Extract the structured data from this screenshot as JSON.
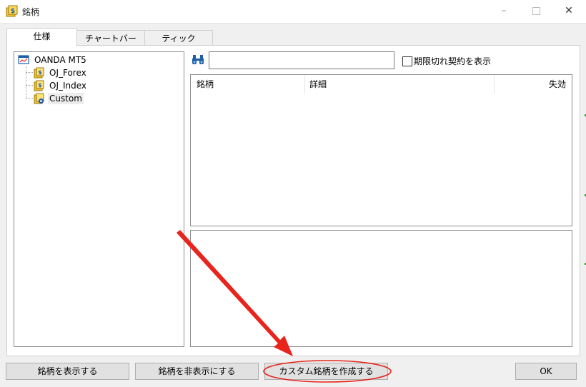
{
  "window": {
    "title": "銘柄",
    "icon": "symbols-app-icon",
    "controls": {
      "minimize": "–",
      "close": "✕"
    }
  },
  "tabs": [
    {
      "label": "仕様",
      "active": true
    },
    {
      "label": "チャートバー",
      "active": false
    },
    {
      "label": "ティック",
      "active": false
    }
  ],
  "tree": {
    "root": {
      "label": "OANDA MT5",
      "icon": "server-icon"
    },
    "children": [
      {
        "label": "OJ_Forex",
        "icon": "folder-symbol-icon"
      },
      {
        "label": "OJ_Index",
        "icon": "folder-symbol-icon"
      },
      {
        "label": "Custom",
        "icon": "custom-folder-gear-icon",
        "selected": true
      }
    ]
  },
  "search": {
    "value": "",
    "icon": "binoculars-icon",
    "show_expired_label": "期限切れ契約を表示",
    "show_expired_checked": false
  },
  "table": {
    "columns": [
      "銘柄",
      "詳細",
      "失効"
    ],
    "rows": []
  },
  "buttons": {
    "show_symbol": "銘柄を表示する",
    "hide_symbol": "銘柄を非表示にする",
    "create_custom": "カスタム銘柄を作成する",
    "ok": "OK"
  },
  "annotation": {
    "color": "#e8241c",
    "target": "create_custom"
  },
  "colors": {
    "accent_blue": "#1f5fa8",
    "folder_yellow": "#f2c12e",
    "annotation_red": "#e8241c"
  }
}
